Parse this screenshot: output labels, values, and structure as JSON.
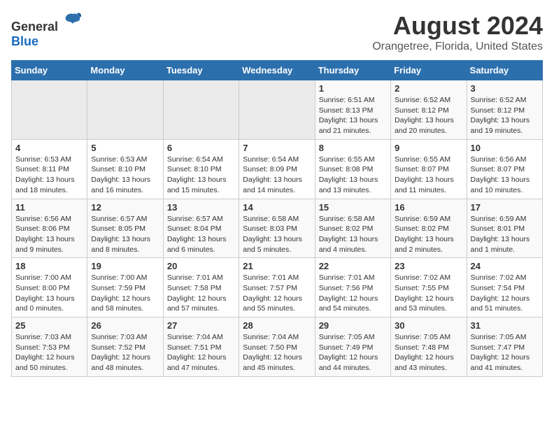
{
  "header": {
    "logo_general": "General",
    "logo_blue": "Blue",
    "title": "August 2024",
    "subtitle": "Orangetree, Florida, United States"
  },
  "days_of_week": [
    "Sunday",
    "Monday",
    "Tuesday",
    "Wednesday",
    "Thursday",
    "Friday",
    "Saturday"
  ],
  "weeks": [
    [
      {
        "day": "",
        "info": ""
      },
      {
        "day": "",
        "info": ""
      },
      {
        "day": "",
        "info": ""
      },
      {
        "day": "",
        "info": ""
      },
      {
        "day": "1",
        "info": "Sunrise: 6:51 AM\nSunset: 8:13 PM\nDaylight: 13 hours and 21 minutes."
      },
      {
        "day": "2",
        "info": "Sunrise: 6:52 AM\nSunset: 8:12 PM\nDaylight: 13 hours and 20 minutes."
      },
      {
        "day": "3",
        "info": "Sunrise: 6:52 AM\nSunset: 8:12 PM\nDaylight: 13 hours and 19 minutes."
      }
    ],
    [
      {
        "day": "4",
        "info": "Sunrise: 6:53 AM\nSunset: 8:11 PM\nDaylight: 13 hours and 18 minutes."
      },
      {
        "day": "5",
        "info": "Sunrise: 6:53 AM\nSunset: 8:10 PM\nDaylight: 13 hours and 16 minutes."
      },
      {
        "day": "6",
        "info": "Sunrise: 6:54 AM\nSunset: 8:10 PM\nDaylight: 13 hours and 15 minutes."
      },
      {
        "day": "7",
        "info": "Sunrise: 6:54 AM\nSunset: 8:09 PM\nDaylight: 13 hours and 14 minutes."
      },
      {
        "day": "8",
        "info": "Sunrise: 6:55 AM\nSunset: 8:08 PM\nDaylight: 13 hours and 13 minutes."
      },
      {
        "day": "9",
        "info": "Sunrise: 6:55 AM\nSunset: 8:07 PM\nDaylight: 13 hours and 11 minutes."
      },
      {
        "day": "10",
        "info": "Sunrise: 6:56 AM\nSunset: 8:07 PM\nDaylight: 13 hours and 10 minutes."
      }
    ],
    [
      {
        "day": "11",
        "info": "Sunrise: 6:56 AM\nSunset: 8:06 PM\nDaylight: 13 hours and 9 minutes."
      },
      {
        "day": "12",
        "info": "Sunrise: 6:57 AM\nSunset: 8:05 PM\nDaylight: 13 hours and 8 minutes."
      },
      {
        "day": "13",
        "info": "Sunrise: 6:57 AM\nSunset: 8:04 PM\nDaylight: 13 hours and 6 minutes."
      },
      {
        "day": "14",
        "info": "Sunrise: 6:58 AM\nSunset: 8:03 PM\nDaylight: 13 hours and 5 minutes."
      },
      {
        "day": "15",
        "info": "Sunrise: 6:58 AM\nSunset: 8:02 PM\nDaylight: 13 hours and 4 minutes."
      },
      {
        "day": "16",
        "info": "Sunrise: 6:59 AM\nSunset: 8:02 PM\nDaylight: 13 hours and 2 minutes."
      },
      {
        "day": "17",
        "info": "Sunrise: 6:59 AM\nSunset: 8:01 PM\nDaylight: 13 hours and 1 minute."
      }
    ],
    [
      {
        "day": "18",
        "info": "Sunrise: 7:00 AM\nSunset: 8:00 PM\nDaylight: 13 hours and 0 minutes."
      },
      {
        "day": "19",
        "info": "Sunrise: 7:00 AM\nSunset: 7:59 PM\nDaylight: 12 hours and 58 minutes."
      },
      {
        "day": "20",
        "info": "Sunrise: 7:01 AM\nSunset: 7:58 PM\nDaylight: 12 hours and 57 minutes."
      },
      {
        "day": "21",
        "info": "Sunrise: 7:01 AM\nSunset: 7:57 PM\nDaylight: 12 hours and 55 minutes."
      },
      {
        "day": "22",
        "info": "Sunrise: 7:01 AM\nSunset: 7:56 PM\nDaylight: 12 hours and 54 minutes."
      },
      {
        "day": "23",
        "info": "Sunrise: 7:02 AM\nSunset: 7:55 PM\nDaylight: 12 hours and 53 minutes."
      },
      {
        "day": "24",
        "info": "Sunrise: 7:02 AM\nSunset: 7:54 PM\nDaylight: 12 hours and 51 minutes."
      }
    ],
    [
      {
        "day": "25",
        "info": "Sunrise: 7:03 AM\nSunset: 7:53 PM\nDaylight: 12 hours and 50 minutes."
      },
      {
        "day": "26",
        "info": "Sunrise: 7:03 AM\nSunset: 7:52 PM\nDaylight: 12 hours and 48 minutes."
      },
      {
        "day": "27",
        "info": "Sunrise: 7:04 AM\nSunset: 7:51 PM\nDaylight: 12 hours and 47 minutes."
      },
      {
        "day": "28",
        "info": "Sunrise: 7:04 AM\nSunset: 7:50 PM\nDaylight: 12 hours and 45 minutes."
      },
      {
        "day": "29",
        "info": "Sunrise: 7:05 AM\nSunset: 7:49 PM\nDaylight: 12 hours and 44 minutes."
      },
      {
        "day": "30",
        "info": "Sunrise: 7:05 AM\nSunset: 7:48 PM\nDaylight: 12 hours and 43 minutes."
      },
      {
        "day": "31",
        "info": "Sunrise: 7:05 AM\nSunset: 7:47 PM\nDaylight: 12 hours and 41 minutes."
      }
    ]
  ]
}
